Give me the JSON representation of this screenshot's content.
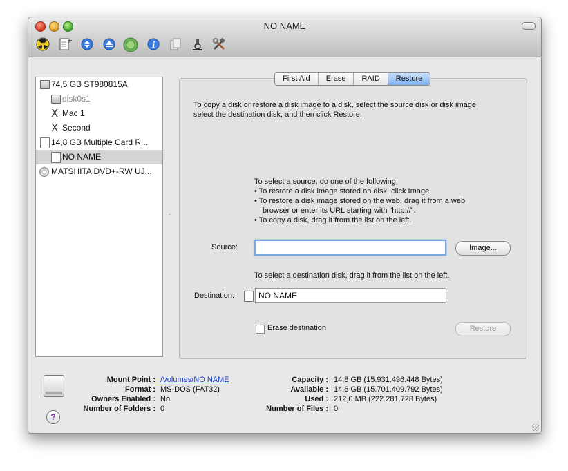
{
  "window": {
    "title": "NO NAME"
  },
  "toolbar": {
    "icons": [
      "burn-icon",
      "new-image-icon",
      "enable-journaling-icon",
      "eject-icon",
      "mount-icon",
      "info-icon",
      "convert-icon",
      "log-icon",
      "tools-icon"
    ]
  },
  "sidebar": {
    "items": [
      {
        "label": "74,5 GB ST980815A",
        "icon": "hard-disk-icon"
      },
      {
        "label": "disk0s1",
        "icon": "volume-icon"
      },
      {
        "label": "Mac 1",
        "icon": "unmounted-volume-icon"
      },
      {
        "label": "Second",
        "icon": "unmounted-volume-icon"
      },
      {
        "label": "14,8 GB Multiple Card R...",
        "icon": "card-reader-icon"
      },
      {
        "label": "NO NAME",
        "icon": "volume-icon"
      },
      {
        "label": "MATSHITA DVD+-RW UJ...",
        "icon": "optical-drive-icon"
      }
    ]
  },
  "tabs": [
    "First Aid",
    "Erase",
    "RAID",
    "Restore"
  ],
  "active_tab": "Restore",
  "restore": {
    "intro_line1": "To copy a disk or restore a disk image to a disk, select the source disk or disk image,",
    "intro_line2": "select the destination disk, and then click Restore.",
    "source_heading": "To select a source, do one of the following:",
    "bullet1": "• To restore a disk image stored on disk, click Image.",
    "bullet2a": "• To restore a disk image stored on the web, drag it from a web",
    "bullet2b": "browser or enter its URL starting with “http://”.",
    "bullet3": "• To copy a disk, drag it from the list on the left.",
    "source_label": "Source:",
    "source_value": "",
    "image_button": "Image...",
    "destination_hint": "To select a destination disk, drag it from the list on the left.",
    "destination_label": "Destination:",
    "destination_value": "NO NAME",
    "erase_label": "Erase destination",
    "erase_checked": false,
    "restore_button": "Restore"
  },
  "info": {
    "mount_point_label": "Mount Point :",
    "mount_point_value": "/Volumes/NO NAME",
    "format_label": "Format :",
    "format_value": "MS-DOS (FAT32)",
    "owners_label": "Owners Enabled :",
    "owners_value": "No",
    "folders_label": "Number of Folders :",
    "folders_value": "0",
    "capacity_label": "Capacity :",
    "capacity_value": "14,8 GB (15.931.496.448 Bytes)",
    "available_label": "Available :",
    "available_value": "14,6 GB (15.701.409.792 Bytes)",
    "used_label": "Used :",
    "used_value": "212,0 MB (222.281.728 Bytes)",
    "files_label": "Number of Files :",
    "files_value": "0"
  },
  "help_glyph": "?"
}
